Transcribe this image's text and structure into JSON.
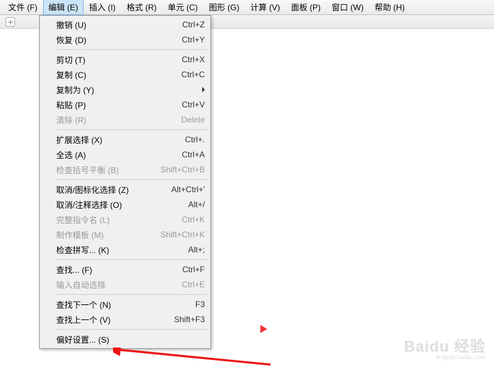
{
  "menubar": [
    {
      "label": "文件 (F)"
    },
    {
      "label": "编辑 (E)",
      "active": true
    },
    {
      "label": "插入 (I)"
    },
    {
      "label": "格式 (R)"
    },
    {
      "label": "单元 (C)"
    },
    {
      "label": "图形 (G)"
    },
    {
      "label": "计算 (V)"
    },
    {
      "label": "面板 (P)"
    },
    {
      "label": "窗口 (W)"
    },
    {
      "label": "帮助 (H)"
    }
  ],
  "dropdown": [
    {
      "label": "撤销 (U)",
      "shortcut": "Ctrl+Z"
    },
    {
      "label": "恢复 (D)",
      "shortcut": "Ctrl+Y"
    },
    {
      "sep": true
    },
    {
      "label": "剪切 (T)",
      "shortcut": "Ctrl+X"
    },
    {
      "label": "复制 (C)",
      "shortcut": "Ctrl+C"
    },
    {
      "label": "复制为 (Y)",
      "submenu": true
    },
    {
      "label": "粘贴 (P)",
      "shortcut": "Ctrl+V"
    },
    {
      "label": "清除 (R)",
      "shortcut": "Delete",
      "disabled": true
    },
    {
      "sep": true
    },
    {
      "label": "扩展选择 (X)",
      "shortcut": "Ctrl+."
    },
    {
      "label": "全选 (A)",
      "shortcut": "Ctrl+A"
    },
    {
      "label": "检查括号平衡 (B)",
      "shortcut": "Shift+Ctrl+B",
      "disabled": true
    },
    {
      "sep": true
    },
    {
      "label": "取消/图标化选择 (Z)",
      "shortcut": "Alt+Ctrl+'"
    },
    {
      "label": "取消/注释选择 (O)",
      "shortcut": "Alt+/"
    },
    {
      "label": "完整指令名 (L)",
      "shortcut": "Ctrl+K",
      "disabled": true
    },
    {
      "label": "制作模板 (M)",
      "shortcut": "Shift+Ctrl+K",
      "disabled": true
    },
    {
      "label": "检查拼写... (K)",
      "shortcut": "Alt+;"
    },
    {
      "sep": true
    },
    {
      "label": "查找... (F)",
      "shortcut": "Ctrl+F"
    },
    {
      "label": "输入自动选择",
      "shortcut": "Ctrl+E",
      "disabled": true
    },
    {
      "sep": true
    },
    {
      "label": "查找下一个 (N)",
      "shortcut": "F3"
    },
    {
      "label": "查找上一个 (V)",
      "shortcut": "Shift+F3"
    },
    {
      "sep": true
    },
    {
      "label": "偏好设置... (S)"
    }
  ],
  "watermark": {
    "main": "Baidu 经验",
    "sub": "jingyan.baidu.com"
  }
}
